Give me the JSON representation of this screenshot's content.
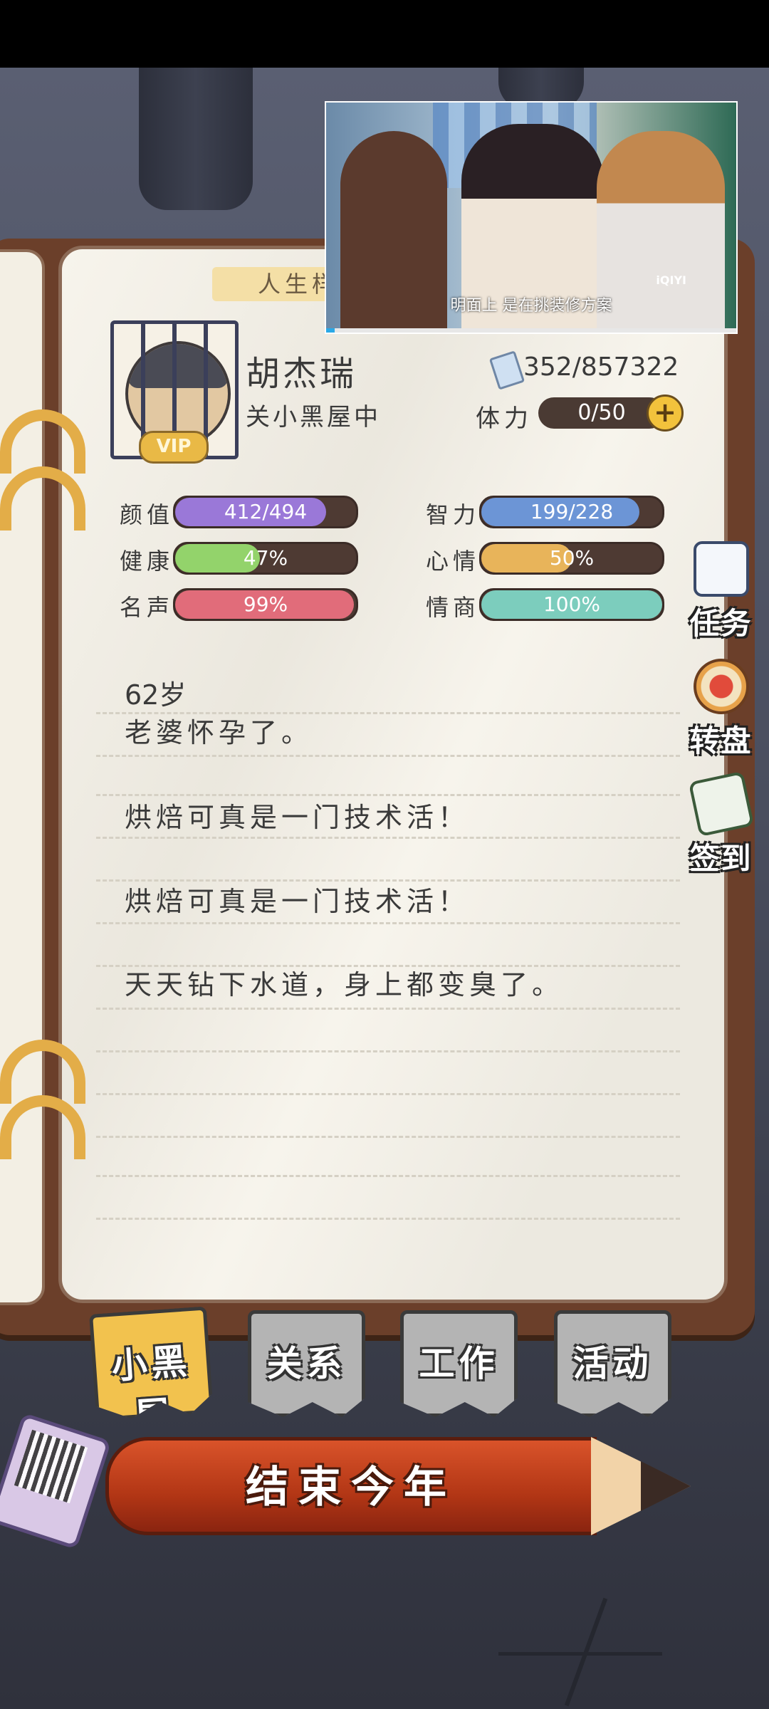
{
  "character": {
    "name": "胡杰瑞",
    "status": "关小黑屋中",
    "vip_label": "VIP",
    "money": "352/857322",
    "stamina_label": "体力",
    "stamina_value": "0/50",
    "stamina_plus": "+"
  },
  "ribbon_label": "人生样",
  "stats": [
    {
      "label": "颜值",
      "value": "412/494",
      "fraction": 0.834,
      "color": "#9a78d8"
    },
    {
      "label": "智力",
      "value": "199/228",
      "fraction": 0.873,
      "color": "#6c95d6"
    },
    {
      "label": "健康",
      "value": "47%",
      "fraction": 0.47,
      "color": "#93d36b"
    },
    {
      "label": "心情",
      "value": "50%",
      "fraction": 0.5,
      "color": "#e8b45a"
    },
    {
      "label": "名声",
      "value": "99%",
      "fraction": 0.99,
      "color": "#e16c7a"
    },
    {
      "label": "情商",
      "value": "100%",
      "fraction": 1.0,
      "color": "#7ccdbd"
    }
  ],
  "log": {
    "age": "62岁",
    "entries": [
      "老婆怀孕了。",
      "烘焙可真是一门技术活！",
      "烘焙可真是一门技术活！",
      "天天钻下水道，身上都变臭了。"
    ]
  },
  "side_buttons": [
    {
      "label": "任务",
      "icon": "clipboard-icon"
    },
    {
      "label": "转盘",
      "icon": "wheel-icon"
    },
    {
      "label": "签到",
      "icon": "calendar-pen-icon"
    }
  ],
  "video": {
    "subtitle": "明面上 是在挑装修方案",
    "watermark": "iQIYI",
    "progress": 0.02
  },
  "tabs": [
    {
      "label": "小黑屋",
      "active": true
    },
    {
      "label": "关系",
      "active": false
    },
    {
      "label": "工作",
      "active": false
    },
    {
      "label": "活动",
      "active": false
    }
  ],
  "end_year_button": "结束今年",
  "colors": {
    "accent": "#f2c24e",
    "pencil": "#b23615"
  }
}
